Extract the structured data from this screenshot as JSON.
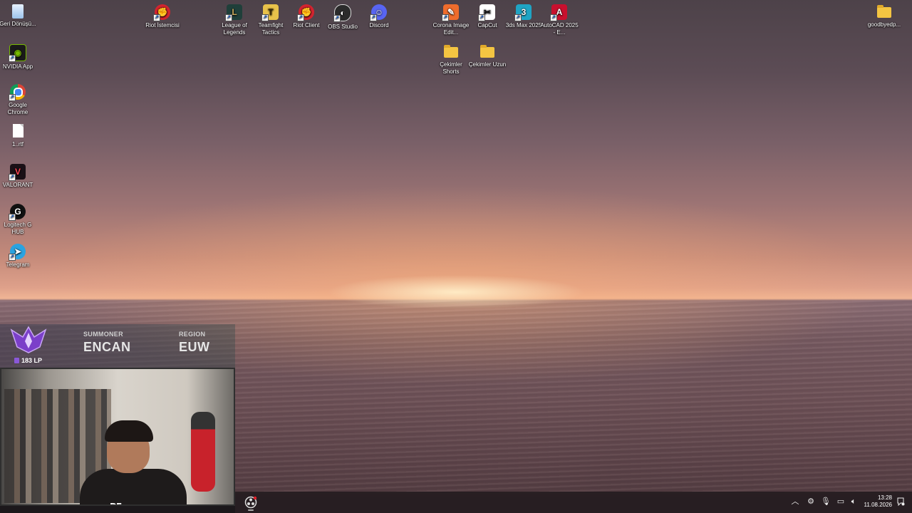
{
  "desktop": {
    "left_icons": [
      {
        "label": "Geri Dönüşü...",
        "icon": "recycle-bin-icon",
        "color": "#bcd7f2"
      },
      {
        "label": "NVIDIA App",
        "icon": "nvidia-icon",
        "color": "#76b900"
      },
      {
        "label": "Google Chrome",
        "icon": "chrome-icon",
        "color": "#4285f4"
      },
      {
        "label": "1..rtf",
        "icon": "document-icon",
        "color": "#ffffff"
      },
      {
        "label": "VALORANT",
        "icon": "valorant-icon",
        "color": "#ff4655"
      },
      {
        "label": "Logitech G HUB",
        "icon": "logitech-ghub-icon",
        "color": "#111111"
      },
      {
        "label": "Telegram",
        "icon": "telegram-icon",
        "color": "#2aa3e0"
      }
    ],
    "top_icons": [
      {
        "label": "Riot İstemcisi",
        "icon": "riot-client-icon",
        "color": "#d3242f"
      },
      {
        "label": "League of Legends",
        "icon": "league-of-legends-icon",
        "color": "#1f3f3a"
      },
      {
        "label": "Teamfight Tactics",
        "icon": "teamfight-tactics-icon",
        "color": "#e8c24a"
      },
      {
        "label": "Riot Client",
        "icon": "riot-client-icon",
        "color": "#d3242f"
      },
      {
        "label": "OBS Studio",
        "icon": "obs-studio-icon",
        "color": "#2b2b2b"
      },
      {
        "label": "Discord",
        "icon": "discord-icon",
        "color": "#5865f2"
      },
      {
        "label": "Corona Image Edit...",
        "icon": "corona-image-editor-icon",
        "color": "#ef6c2c"
      },
      {
        "label": "CapCut",
        "icon": "capcut-icon",
        "color": "#111111"
      },
      {
        "label": "3ds Max 2025",
        "icon": "3ds-max-icon",
        "color": "#1fa4c4"
      },
      {
        "label": "AutoCAD 2025 - E...",
        "icon": "autocad-icon",
        "color": "#c8102e"
      },
      {
        "label": "Çekimler Shorts",
        "icon": "folder-icon",
        "color": "#f4c542"
      },
      {
        "label": "Çekimler Uzun",
        "icon": "folder-icon",
        "color": "#f4c542"
      },
      {
        "label": "goodbyedp...",
        "icon": "folder-icon",
        "color": "#f4c542"
      }
    ]
  },
  "overlay": {
    "lp": "183 LP",
    "summoner_label": "SUMMONER",
    "summoner_value": "ENCAN",
    "region_label": "REGION",
    "region_value": "EUW",
    "rank_icon": "master-rank-emblem-icon",
    "accent": "#8a58d8",
    "webcam_logo": "DE"
  },
  "taskbar": {
    "pinned_app_icon": "obs-studio-icon",
    "tray_icons": [
      "chevron-up-icon",
      "gear-tray-icon",
      "microphone-icon",
      "network-icon",
      "speaker-icon"
    ],
    "time": "13:28",
    "date": "11.08.2026",
    "notification_icon": "notification-icon"
  }
}
